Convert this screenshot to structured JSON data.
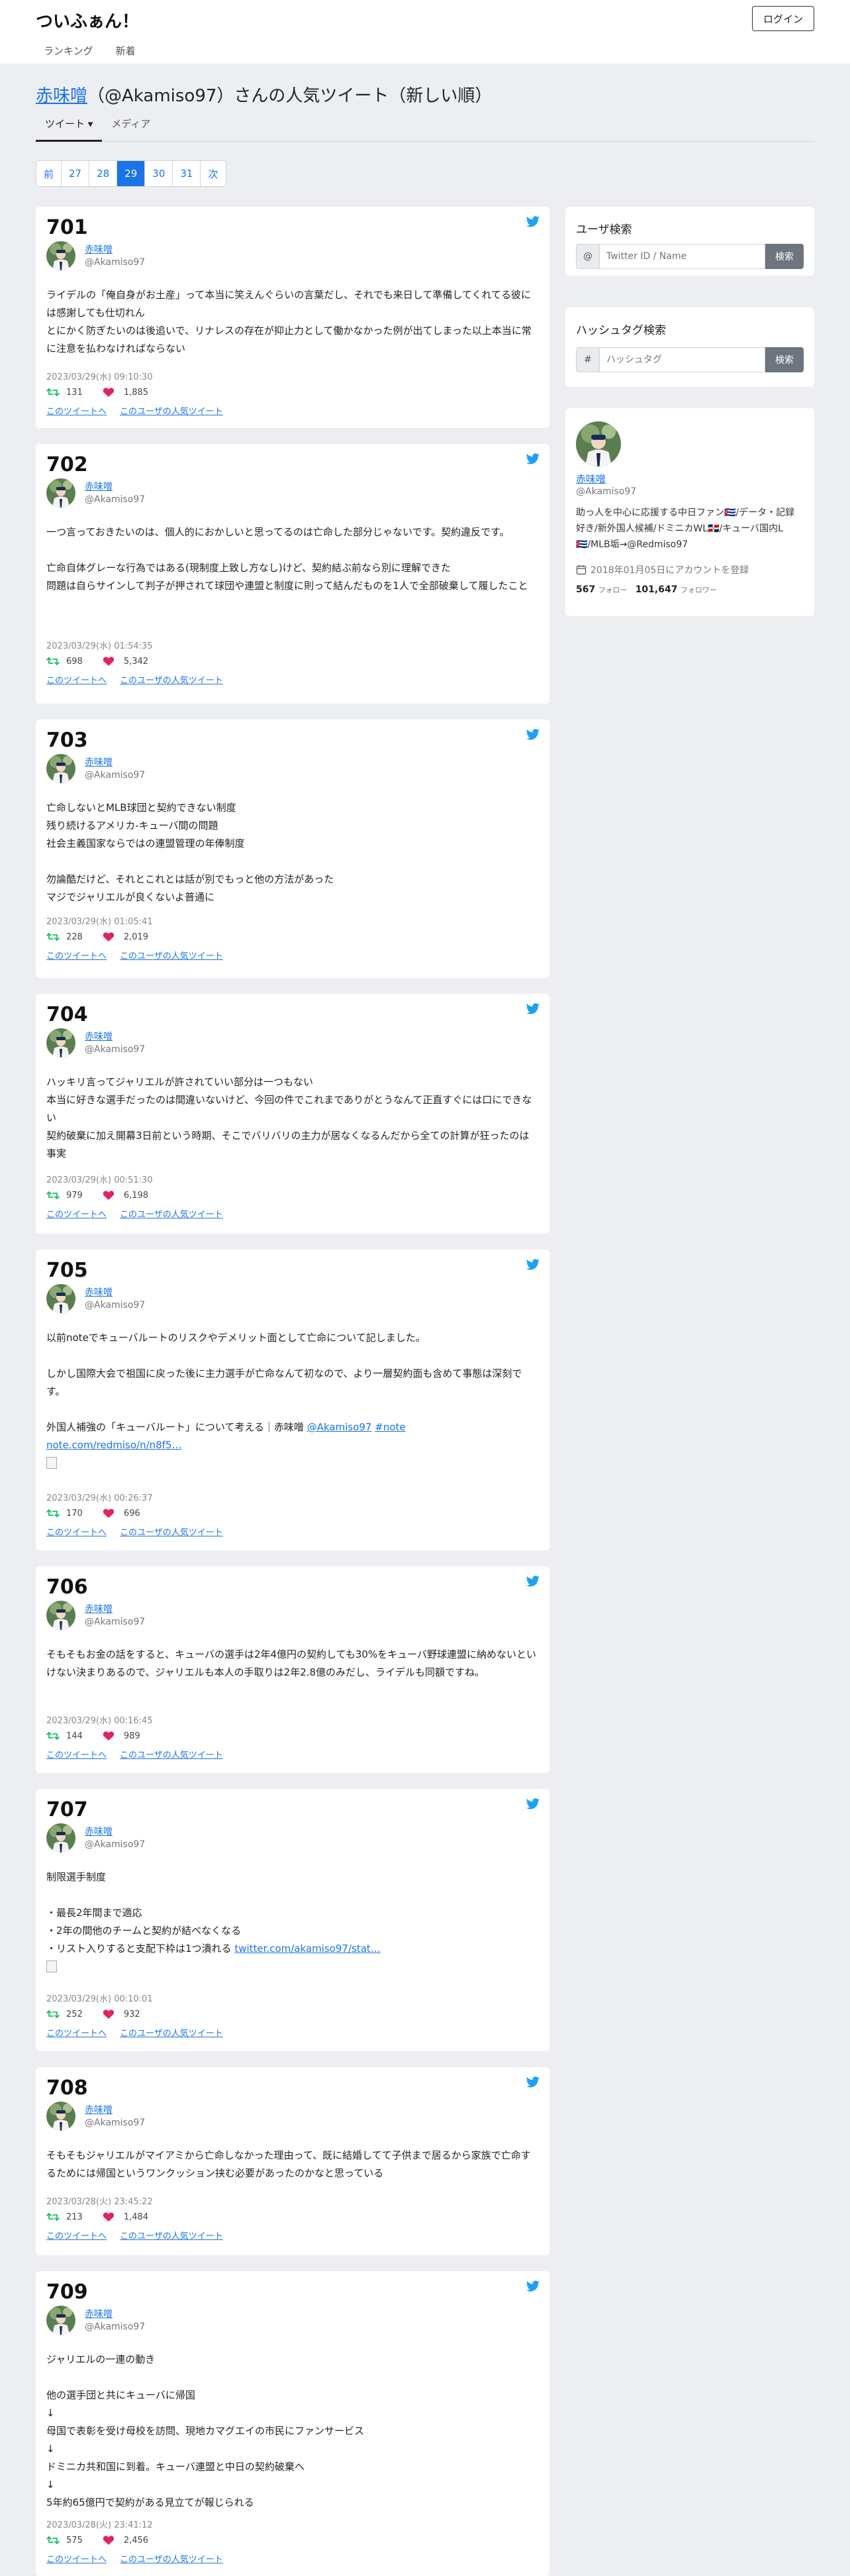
{
  "header": {
    "brand": "ついふぁん！",
    "login": "ログイン",
    "nav": [
      "ランキング",
      "新着"
    ]
  },
  "page": {
    "title_user": "赤味噌",
    "title_rest": "（@Akamiso97）さんの人気ツイート（新しい順）",
    "tabs": [
      "ツイート ▾",
      "メディア"
    ]
  },
  "pager": [
    "前",
    "27",
    "28",
    "29",
    "30",
    "31",
    "次"
  ],
  "pager_active": "29",
  "user": {
    "name": "赤味噌",
    "id": "@Akamiso97"
  },
  "links": {
    "tweet": "このツイートへ",
    "user": "このユーザの人気ツイート"
  },
  "tweets": [
    {
      "num": "701",
      "text": "ライデルの「俺自身がお土産」って本当に笑えんぐらいの言葉だし、それでも来日して準備してくれてる彼には感謝しても仕切れん\nとにかく防ぎたいのは後追いで、リナレスの存在が抑止力として働かなかった例が出てしまった以上本当に常に注意を払わなければならない",
      "date": "2023/03/29(水) 09:10:30",
      "rt": "131",
      "like": "1,885"
    },
    {
      "num": "702",
      "text": "一つ言っておきたいのは、個人的におかしいと思ってるのは亡命した部分じゃないです。契約違反です。\n\n亡命自体グレーな行為ではある(現制度上致し方なし)けど、契約結ぶ前なら別に理解できた\n問題は自らサインして判子が押されて球団や連盟と制度に則って結んだものを1人で全部破棄して履したこと",
      "date": "2023/03/29(水) 01:54:35",
      "rt": "698",
      "like": "5,342"
    },
    {
      "num": "703",
      "text": "亡命しないとMLB球団と契約できない制度\n残り続けるアメリカ-キューバ間の問題\n社会主義国家ならではの連盟管理の年俸制度\n\n勿論酷だけど、それとこれとは話が別でもっと他の方法があった\nマジでジャリエルが良くないよ普通に",
      "date": "2023/03/29(水) 01:05:41",
      "rt": "228",
      "like": "2,019"
    },
    {
      "num": "704",
      "text": "ハッキリ言ってジャリエルが許されていい部分は一つもない\n本当に好きな選手だったのは間違いないけど、今回の件でこれまでありがとうなんて正直すぐには口にできない\n契約破棄に加え開幕3日前という時期、そこでバリバリの主力が居なくなるんだから全ての計算が狂ったのは事実",
      "date": "2023/03/29(水) 00:51:30",
      "rt": "979",
      "like": "6,198"
    },
    {
      "num": "705",
      "text": "以前noteでキューバルートのリスクやデメリット面として亡命について記しました。\n\nしかし国際大会で祖国に戻った後に主力選手が亡命なんて初なので、より一層契約面も含めて事態は深刻です。\n\n外国人補強の「キューバルート」について考える｜赤味噌 ",
      "tag1": "@Akamiso97",
      "tag2": "#note",
      "link": "note.com/redmiso/n/n8f5…",
      "date": "2023/03/29(水) 00:26:37",
      "rt": "170",
      "like": "696"
    },
    {
      "num": "706",
      "text": "そもそもお金の話をすると、キューバの選手は2年4億円の契約しても30%をキューバ野球連盟に納めないといけない決まりあるので、ジャリエルも本人の手取りは2年2.8億のみだし、ライデルも同額ですね。",
      "date": "2023/03/29(水) 00:16:45",
      "rt": "144",
      "like": "989"
    },
    {
      "num": "707",
      "text": "制限選手制度\n\n・最長2年間まで適応\n・2年の間他のチームと契約が結べなくなる\n・リスト入りすると支配下枠は1つ潰れる ",
      "link": "twitter.com/akamiso97/stat…",
      "date": "2023/03/29(水) 00:10:01",
      "rt": "252",
      "like": "932"
    },
    {
      "num": "708",
      "text": "そもそもジャリエルがマイアミから亡命しなかった理由って、既に結婚してて子供まで居るから家族で亡命するためには帰国というワンクッション挟む必要があったのかなと思っている",
      "date": "2023/03/28(火) 23:45:22",
      "rt": "213",
      "like": "1,484"
    },
    {
      "num": "709",
      "text": "ジャリエルの一連の動き\n\n他の選手団と共にキューバに帰国\n↓\n母国で表彰を受け母校を訪問、現地カマグエイの市民にファンサービス\n↓\nドミニカ共和国に到着。キューバ連盟と中日の契約破棄へ\n↓\n5年約65億円で契約がある見立てが報じられる",
      "date": "2023/03/28(火) 23:41:12",
      "rt": "575",
      "like": "2,456"
    }
  ],
  "sidebar": {
    "user_search": {
      "title": "ユーザ検索",
      "prefix": "@",
      "placeholder": "Twitter ID / Name",
      "button": "検索"
    },
    "hashtag_search": {
      "title": "ハッシュタグ検索",
      "prefix": "#",
      "placeholder": "ハッシュタグ",
      "button": "検索"
    },
    "profile": {
      "name": "赤味噌",
      "id": "@Akamiso97",
      "bio": "助っ人を中心に応援する中日ファン🇨🇺/データ・記録好き/新外国人候補/ドミニカWL🇩🇴/キューバ国内L🇨🇺/MLB垢→@Redmiso97",
      "registered": "2018年01月05日にアカウントを登録",
      "following": "567",
      "following_label": "フォロー",
      "followers": "101,647",
      "followers_label": "フォロワー"
    }
  },
  "colors": {
    "accent": "#1a73e8",
    "twitter": "#1da1f2",
    "retweet": "#17bf63",
    "like": "#e0245e",
    "page_bg": "#eceef1"
  },
  "icons": {
    "tweet_badge": "twitter-bird-icon",
    "retweet": "retweet-icon",
    "like": "heart-icon",
    "calendar": "calendar-icon"
  }
}
